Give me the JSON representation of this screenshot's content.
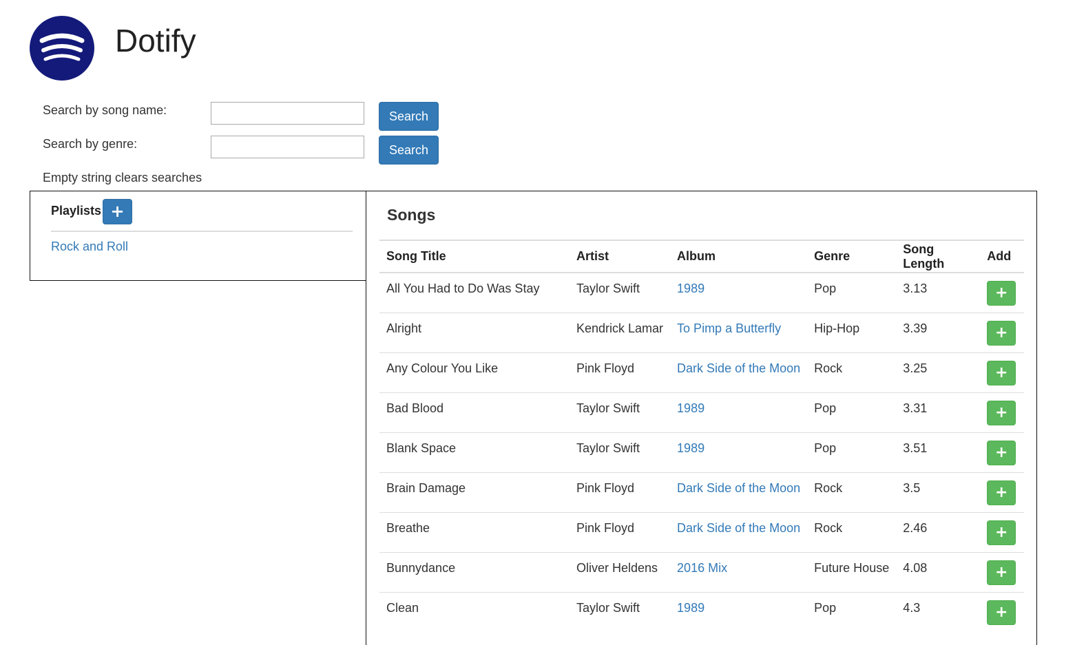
{
  "app": {
    "title": "Dotify",
    "logo_icon": "spotify-style-logo",
    "logo_color": "#141a7a"
  },
  "search": {
    "song_label": "Search by song name:",
    "song_value": "",
    "song_button": "Search",
    "genre_label": "Search by genre:",
    "genre_value": "",
    "genre_button": "Search",
    "hint": "Empty string clears searches"
  },
  "playlists": {
    "title": "Playlists",
    "add_icon": "plus-icon",
    "items": [
      {
        "label": "Rock and Roll"
      }
    ]
  },
  "songs": {
    "title": "Songs",
    "columns": [
      "Song Title",
      "Artist",
      "Album",
      "Genre",
      "Song Length",
      "Add"
    ],
    "rows": [
      {
        "title": "All You Had to Do Was Stay",
        "artist": "Taylor Swift",
        "album": "1989",
        "genre": "Pop",
        "length": "3.13"
      },
      {
        "title": "Alright",
        "artist": "Kendrick Lamar",
        "album": "To Pimp a Butterfly",
        "genre": "Hip-Hop",
        "length": "3.39"
      },
      {
        "title": "Any Colour You Like",
        "artist": "Pink Floyd",
        "album": "Dark Side of the Moon",
        "genre": "Rock",
        "length": "3.25"
      },
      {
        "title": "Bad Blood",
        "artist": "Taylor Swift",
        "album": "1989",
        "genre": "Pop",
        "length": "3.31"
      },
      {
        "title": "Blank Space",
        "artist": "Taylor Swift",
        "album": "1989",
        "genre": "Pop",
        "length": "3.51"
      },
      {
        "title": "Brain Damage",
        "artist": "Pink Floyd",
        "album": "Dark Side of the Moon",
        "genre": "Rock",
        "length": "3.5"
      },
      {
        "title": "Breathe",
        "artist": "Pink Floyd",
        "album": "Dark Side of the Moon",
        "genre": "Rock",
        "length": "2.46"
      },
      {
        "title": "Bunnydance",
        "artist": "Oliver Heldens",
        "album": "2016 Mix",
        "genre": "Future House",
        "length": "4.08"
      },
      {
        "title": "Clean",
        "artist": "Taylor Swift",
        "album": "1989",
        "genre": "Pop",
        "length": "4.3"
      }
    ],
    "add_icon": "plus-icon"
  },
  "colors": {
    "primary": "#337ab7",
    "success": "#5cb85c",
    "link": "#337ab7"
  }
}
